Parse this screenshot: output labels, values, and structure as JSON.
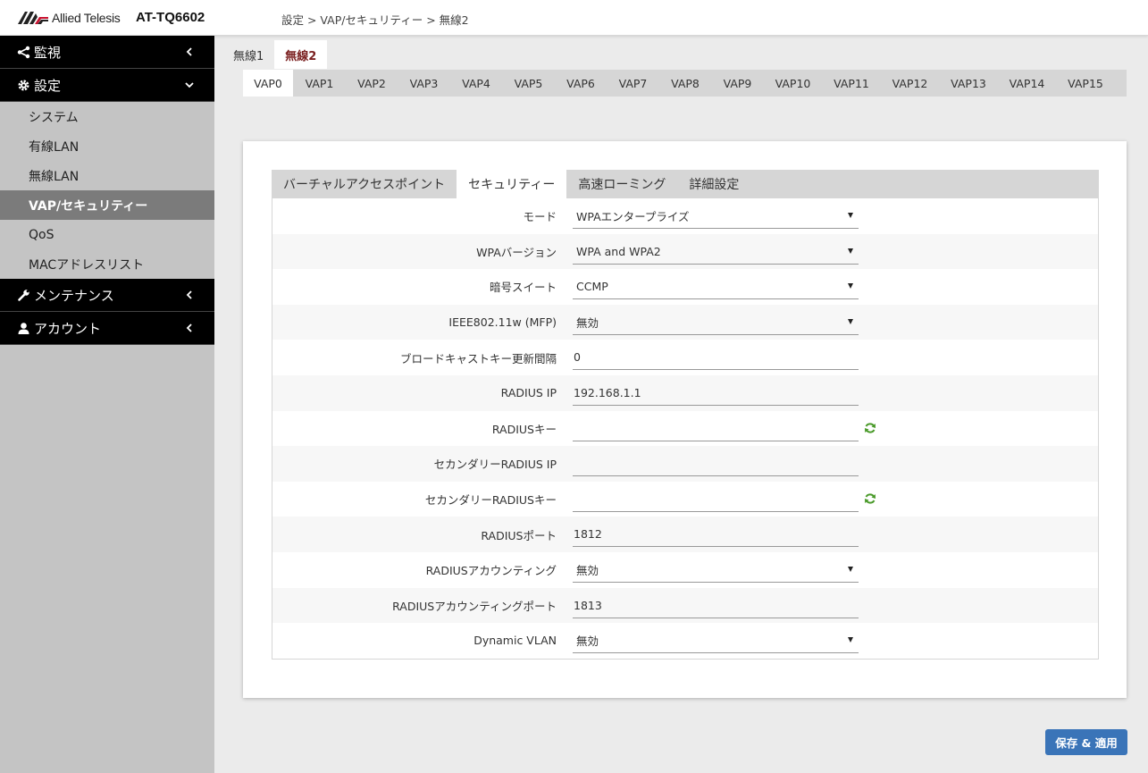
{
  "header": {
    "brand": "Allied Telesis",
    "model": "AT-TQ6602",
    "breadcrumb": "設定 > VAP/セキュリティー > 無線2"
  },
  "sidebar": {
    "groups": [
      {
        "label": "監視",
        "icon": "share-icon"
      },
      {
        "label": "設定",
        "icon": "gear-icon"
      },
      {
        "label": "メンテナンス",
        "icon": "wrench-icon"
      },
      {
        "label": "アカウント",
        "icon": "user-icon"
      }
    ],
    "settings_items": [
      {
        "label": "システム"
      },
      {
        "label": "有線LAN"
      },
      {
        "label": "無線LAN"
      },
      {
        "label": "VAP/セキュリティー",
        "active": true
      },
      {
        "label": "QoS"
      },
      {
        "label": "MACアドレスリスト"
      }
    ]
  },
  "radio_tabs": [
    {
      "label": "無線1",
      "active": false
    },
    {
      "label": "無線2",
      "active": true
    }
  ],
  "vap_tabs": [
    "VAP0",
    "VAP1",
    "VAP2",
    "VAP3",
    "VAP4",
    "VAP5",
    "VAP6",
    "VAP7",
    "VAP8",
    "VAP9",
    "VAP10",
    "VAP11",
    "VAP12",
    "VAP13",
    "VAP14",
    "VAP15"
  ],
  "vap_active": "VAP0",
  "sub_tabs": [
    {
      "label": "バーチャルアクセスポイント",
      "active": false
    },
    {
      "label": "セキュリティー",
      "active": true
    },
    {
      "label": "高速ローミング",
      "active": false
    },
    {
      "label": "詳細設定",
      "active": false
    }
  ],
  "form": {
    "mode": {
      "label": "モード",
      "value": "WPAエンタープライズ"
    },
    "wpa_version": {
      "label": "WPAバージョン",
      "value": "WPA and WPA2"
    },
    "cipher_suite": {
      "label": "暗号スイート",
      "value": "CCMP"
    },
    "mfp": {
      "label": "IEEE802.11w (MFP)",
      "value": "無効"
    },
    "broadcast_key_interval": {
      "label": "ブロードキャストキー更新間隔",
      "value": "0"
    },
    "radius_ip": {
      "label": "RADIUS IP",
      "value": "192.168.1.1"
    },
    "radius_key": {
      "label": "RADIUSキー",
      "value": ""
    },
    "secondary_radius_ip": {
      "label": "セカンダリーRADIUS IP",
      "value": ""
    },
    "secondary_radius_key": {
      "label": "セカンダリーRADIUSキー",
      "value": ""
    },
    "radius_port": {
      "label": "RADIUSポート",
      "value": "1812"
    },
    "radius_accounting": {
      "label": "RADIUSアカウンティング",
      "value": "無効"
    },
    "radius_accounting_port": {
      "label": "RADIUSアカウンティングポート",
      "value": "1813"
    },
    "dynamic_vlan": {
      "label": "Dynamic VLAN",
      "value": "無効"
    }
  },
  "actions": {
    "save_label": "保存 & 適用"
  },
  "colors": {
    "accent": "#3a74b8",
    "active_tab_text": "#7a1f1f",
    "refresh_icon": "#4a9a2a"
  }
}
